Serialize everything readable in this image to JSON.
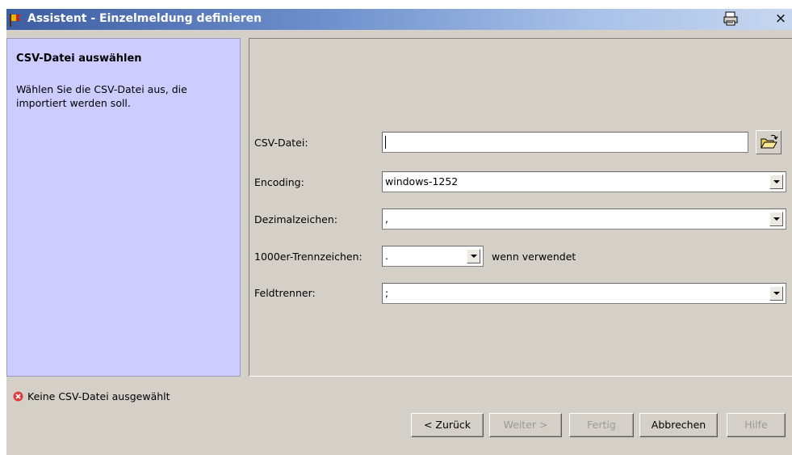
{
  "window": {
    "title": "Assistent - Einzelmeldung definieren",
    "close_glyph": "×"
  },
  "left_panel": {
    "heading": "CSV-Datei auswählen",
    "description": "Wählen Sie die CSV-Datei aus, die importiert werden soll."
  },
  "form": {
    "csv_file": {
      "label": "CSV-Datei:",
      "value": ""
    },
    "encoding": {
      "label": "Encoding:",
      "value": "windows-1252"
    },
    "decimal": {
      "label": "Dezimalzeichen:",
      "value": ","
    },
    "thousands": {
      "label": "1000er-Trennzeichen:",
      "value": ".",
      "suffix": "wenn verwendet"
    },
    "field_sep": {
      "label": "Feldtrenner:",
      "value": ";"
    }
  },
  "status": {
    "message": "Keine CSV-Datei ausgewählt",
    "icon": "error-icon",
    "icon_color": "#e03c3c"
  },
  "buttons": {
    "back": "< Zurück",
    "next": "Weiter >",
    "finish": "Fertig",
    "cancel": "Abbrechen",
    "help": "Hilfe"
  },
  "icons": {
    "app": "app-flag-icon",
    "print": "printer-icon",
    "close": "close-icon",
    "browse": "open-folder-icon",
    "dropdown": "chevron-down-icon"
  },
  "colors": {
    "title_gradient_start": "#3c5ea2",
    "title_gradient_end": "#c6d6ef",
    "left_panel_bg": "#ccccfe",
    "dialog_bg": "#d4d0c8"
  }
}
